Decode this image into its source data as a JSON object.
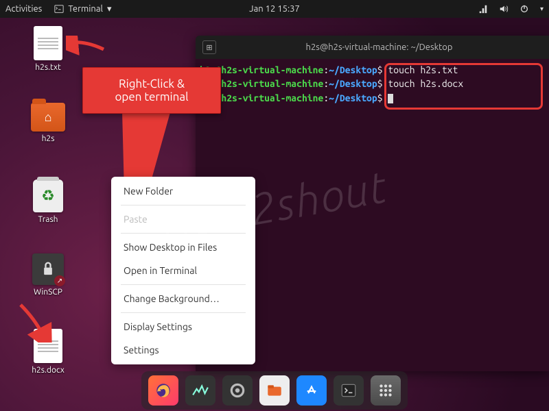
{
  "topbar": {
    "activities": "Activities",
    "terminal_label": "Terminal",
    "datetime": "Jan 12  15:37"
  },
  "desktop_icons": {
    "txt": "h2s.txt",
    "home": "h2s",
    "trash": "Trash",
    "winscp": "WinSCP",
    "docx": "h2s.docx"
  },
  "callout": {
    "line1": "Right-Click &",
    "line2": "open terminal"
  },
  "terminal": {
    "title": "h2s@h2s-virtual-machine: ~/Desktop",
    "user": "h2s@h2s-virtual-machine",
    "colon": ":",
    "path": "~/Desktop",
    "prompt": "$",
    "cmd1": " touch h2s.txt",
    "cmd2": " touch h2s.docx",
    "cmd3": " "
  },
  "context_menu": {
    "new_folder": "New Folder",
    "paste": "Paste",
    "show_in_files": "Show Desktop in Files",
    "open_terminal": "Open in Terminal",
    "change_bg": "Change Background…",
    "display_settings": "Display Settings",
    "settings": "Settings"
  },
  "watermark": "How2shout"
}
